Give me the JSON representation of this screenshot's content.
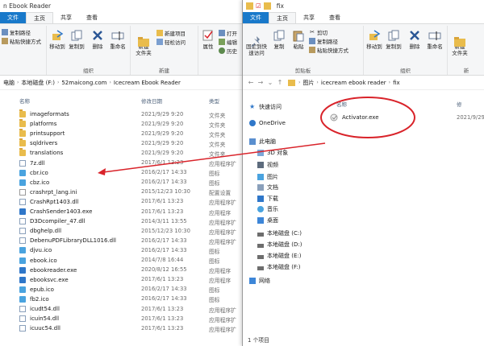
{
  "left": {
    "title": "n Ebook Reader",
    "tabs": [
      "文件",
      "主页",
      "共享",
      "查看"
    ],
    "ribbon": {
      "copy_path": "复制路径",
      "paste_shortcut": "粘贴快捷方式",
      "move_to": "移动到",
      "copy_to": "复制到",
      "delete": "删除",
      "rename": "重命名",
      "new_folder": "新建\n文件夹",
      "new_item": "新建项目",
      "easy_access": "轻松访问",
      "properties": "属性",
      "open": "打开",
      "edit": "编辑",
      "history": "历史",
      "group_organize": "组织",
      "group_new": "新建"
    },
    "breadcrumbs": [
      "电脑",
      "本地磁盘 (F:)",
      "52maicong.com",
      "Icecream Ebook Reader"
    ],
    "columns": {
      "name": "名称",
      "date": "修改日期",
      "type": "类型"
    },
    "files": [
      {
        "name": "imageformats",
        "date": "2021/9/29 9:20",
        "type": "文件夹",
        "icon": "folder"
      },
      {
        "name": "platforms",
        "date": "2021/9/29 9:20",
        "type": "文件夹",
        "icon": "folder"
      },
      {
        "name": "printsupport",
        "date": "2021/9/29 9:20",
        "type": "文件夹",
        "icon": "folder"
      },
      {
        "name": "sqldrivers",
        "date": "2021/9/29 9:20",
        "type": "文件夹",
        "icon": "folder"
      },
      {
        "name": "translations",
        "date": "2021/9/29 9:20",
        "type": "文件夹",
        "icon": "folder"
      },
      {
        "name": "7z.dll",
        "date": "2017/6/1 13:23",
        "type": "应用程序扩",
        "icon": "doc"
      },
      {
        "name": "cbr.ico",
        "date": "2016/2/17 14:33",
        "type": "图标",
        "icon": "ico"
      },
      {
        "name": "cbz.ico",
        "date": "2016/2/17 14:33",
        "type": "图标",
        "icon": "ico"
      },
      {
        "name": "crashrpt_lang.ini",
        "date": "2015/12/23 10:30",
        "type": "配置设置",
        "icon": "ini"
      },
      {
        "name": "CrashRpt1403.dll",
        "date": "2017/6/1 13:23",
        "type": "应用程序扩",
        "icon": "doc"
      },
      {
        "name": "CrashSender1403.exe",
        "date": "2017/6/1 13:23",
        "type": "应用程序",
        "icon": "exe"
      },
      {
        "name": "D3Dcompiler_47.dll",
        "date": "2014/3/11 13:55",
        "type": "应用程序扩",
        "icon": "doc"
      },
      {
        "name": "dbghelp.dll",
        "date": "2015/12/23 10:30",
        "type": "应用程序扩",
        "icon": "doc"
      },
      {
        "name": "DebenuPDFLibraryDLL1016.dll",
        "date": "2016/2/17 14:33",
        "type": "应用程序扩",
        "icon": "doc"
      },
      {
        "name": "djvu.ico",
        "date": "2016/2/17 14:33",
        "type": "图标",
        "icon": "ico"
      },
      {
        "name": "ebook.ico",
        "date": "2014/7/8 16:44",
        "type": "图标",
        "icon": "ico"
      },
      {
        "name": "ebookreader.exe",
        "date": "2020/8/12 16:55",
        "type": "应用程序",
        "icon": "exe"
      },
      {
        "name": "ebooksvc.exe",
        "date": "2017/6/1 13:23",
        "type": "应用程序",
        "icon": "exe"
      },
      {
        "name": "epub.ico",
        "date": "2016/2/17 14:33",
        "type": "图标",
        "icon": "ico"
      },
      {
        "name": "fb2.ico",
        "date": "2016/2/17 14:33",
        "type": "图标",
        "icon": "ico"
      },
      {
        "name": "icudt54.dll",
        "date": "2017/6/1 13:23",
        "type": "应用程序扩",
        "icon": "doc"
      },
      {
        "name": "icuin54.dll",
        "date": "2017/6/1 13:23",
        "type": "应用程序扩",
        "icon": "doc"
      },
      {
        "name": "icuuc54.dll",
        "date": "2017/6/1 13:23",
        "type": "应用程序扩",
        "icon": "doc"
      }
    ]
  },
  "right": {
    "title": "fix",
    "tabs": [
      "文件",
      "主页",
      "共享",
      "查看"
    ],
    "ribbon": {
      "pin_quick": "固定到快\n速访问",
      "copy": "复制",
      "paste": "粘贴",
      "cut": "剪切",
      "copy_path": "复制路径",
      "paste_shortcut": "粘贴快捷方式",
      "move_to": "移动到",
      "copy_to": "复制到",
      "delete": "删除",
      "rename": "重命名",
      "new_folder": "新建\n文件夹",
      "group_clipboard": "剪贴板",
      "group_organize": "组织",
      "group_new": "新"
    },
    "breadcrumbs": [
      "图片",
      "icecream ebook reader",
      "fix"
    ],
    "columns": {
      "name": "名称",
      "date": "修"
    },
    "files": [
      {
        "name": "Activator.exe",
        "date": "2021/9/29"
      }
    ],
    "nav": [
      {
        "label": "快速访问",
        "icon": "star"
      },
      {
        "label": "OneDrive",
        "icon": "cloud"
      },
      {
        "label": "此电脑",
        "icon": "pc"
      },
      {
        "label": "3D 对象",
        "icon": "cube"
      },
      {
        "label": "视频",
        "icon": "video"
      },
      {
        "label": "图片",
        "icon": "pic"
      },
      {
        "label": "文档",
        "icon": "doc"
      },
      {
        "label": "下载",
        "icon": "down"
      },
      {
        "label": "音乐",
        "icon": "music"
      },
      {
        "label": "桌面",
        "icon": "desk"
      },
      {
        "label": "本地磁盘 (C:)",
        "icon": "drive"
      },
      {
        "label": "本地磁盘 (D:)",
        "icon": "drive"
      },
      {
        "label": "本地磁盘 (E:)",
        "icon": "drive"
      },
      {
        "label": "本地磁盘 (F:)",
        "icon": "drive"
      },
      {
        "label": "网络",
        "icon": "net"
      }
    ],
    "status": "1 个项目"
  },
  "colors": {
    "file_tab": "#1979ca",
    "annotation": "#d9232a",
    "folder": "#e9bc4c"
  }
}
